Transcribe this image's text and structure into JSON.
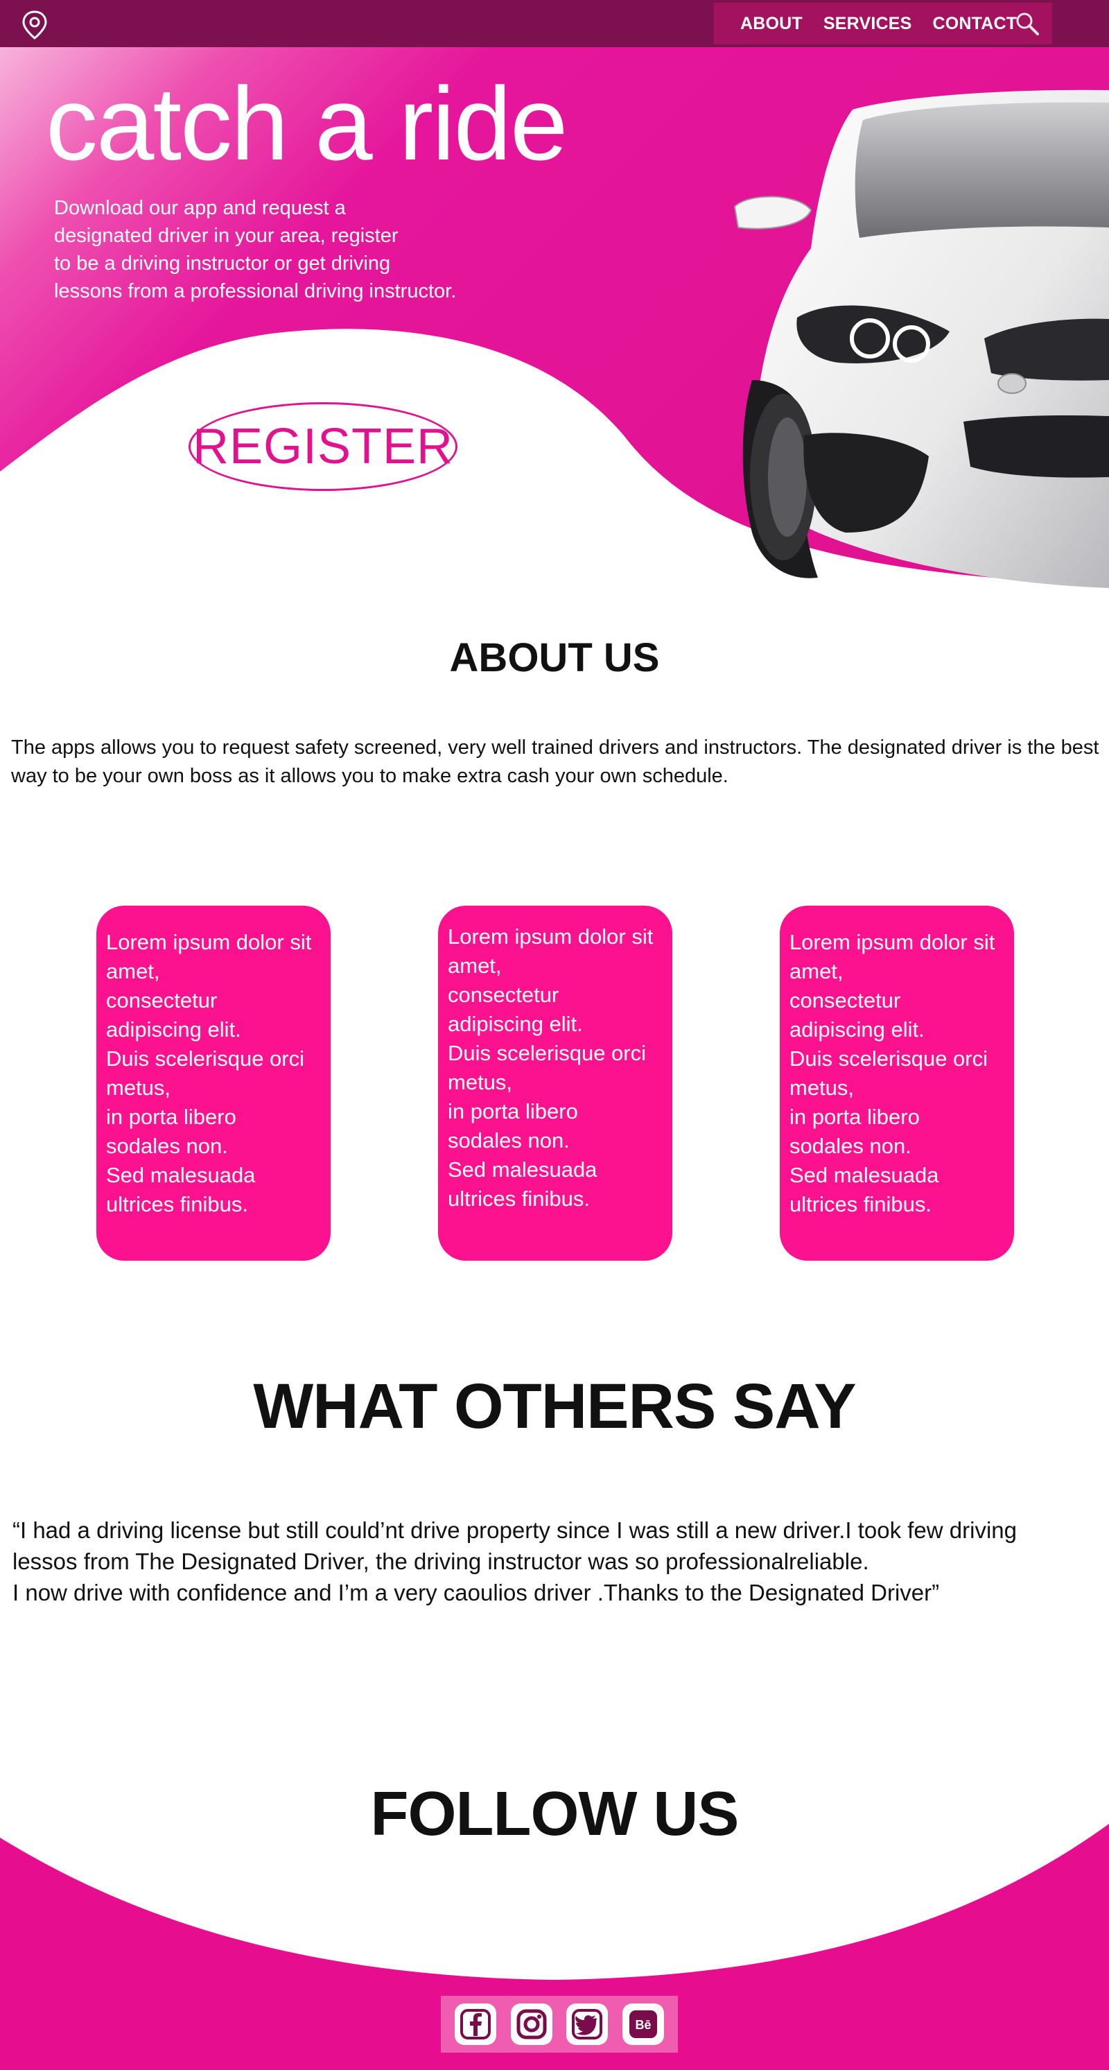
{
  "nav": {
    "items": [
      "ABOUT",
      "SERVICES",
      "CONTACT"
    ]
  },
  "hero": {
    "title": "catch a ride",
    "lines": [
      "Download our app and request a",
      "designated driver in your area, register",
      "to be a driving instructor or get driving",
      "lessons from a professional driving instructor."
    ],
    "register_label": "REGISTER"
  },
  "about": {
    "title": "ABOUT US",
    "text": "The apps allows you to request safety screened, very well trained drivers and instructors. The designated driver is the best way to be your own boss as it allows you to make extra cash your own schedule."
  },
  "cards": [
    {
      "lines": [
        "Lorem ipsum dolor sit",
        "amet,",
        "consectetur",
        "adipiscing elit.",
        "Duis scelerisque orci",
        "metus,",
        "in porta libero",
        "sodales non.",
        "Sed malesuada",
        "ultrices finibus."
      ]
    },
    {
      "lines": [
        "Lorem ipsum dolor sit",
        "amet,",
        "consectetur",
        "adipiscing elit.",
        "Duis scelerisque orci",
        "metus,",
        "in porta libero",
        "sodales non.",
        "Sed malesuada",
        "ultrices finibus."
      ]
    },
    {
      "lines": [
        "Lorem ipsum dolor sit",
        "amet,",
        "consectetur",
        "adipiscing elit.",
        "Duis scelerisque orci",
        "metus,",
        "in porta libero",
        "sodales non.",
        "Sed malesuada",
        "ultrices finibus."
      ]
    }
  ],
  "testimonials": {
    "title": "WHAT OTHERS SAY",
    "quote_lines": [
      "“I had a driving license but still could’nt drive property since I was still a new driver.I took few driving",
      "lessos from The Designated Driver, the driving instructor was so professionalreliable.",
      "I now drive with confidence and I’m a very caoulios driver .Thanks to the  Designated Driver”"
    ]
  },
  "footer": {
    "title": "FOLLOW US",
    "social": [
      "facebook-icon",
      "instagram-icon",
      "twitter-icon",
      "behance-icon"
    ]
  },
  "colors": {
    "top_bar": "#7d1150",
    "nav_bg": "#a2125f",
    "primary_pink": "#e0108f",
    "card_pink": "#fc128e",
    "social_bar": "#f05db0"
  }
}
